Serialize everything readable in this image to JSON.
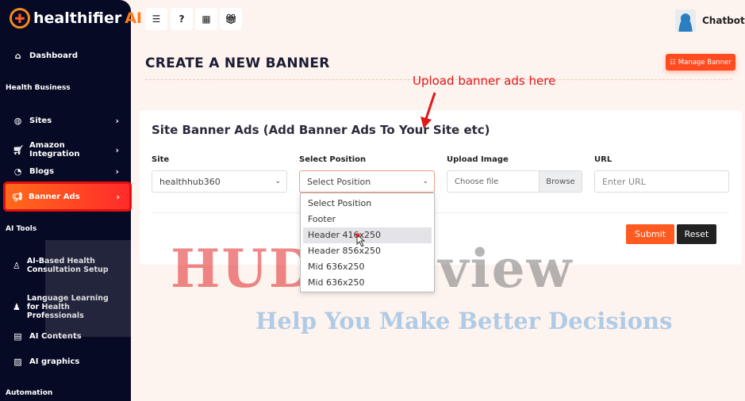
{
  "brand": {
    "name": "healthifier",
    "suffix": "AI"
  },
  "sidebar": {
    "dashboard": "Dashboard",
    "sections": {
      "health_business": "Health Business",
      "ai_tools": "AI Tools",
      "automation": "Automation"
    },
    "items": [
      {
        "label": "Sites",
        "icon": "globe-icon"
      },
      {
        "label": "Amazon Integration",
        "icon": "cart-icon"
      },
      {
        "label": "Blogs",
        "icon": "rss-icon"
      },
      {
        "label": "Banner Ads",
        "icon": "megaphone-icon",
        "active": true
      }
    ],
    "ai_items": [
      {
        "label": "AI-Based Health Consultation Setup"
      },
      {
        "label": "Language Learning for Health Professionals"
      },
      {
        "label": "AI Contents"
      },
      {
        "label": "AI graphics"
      }
    ]
  },
  "topbar": {
    "icons": [
      "menu-icon",
      "help-icon",
      "film-icon",
      "gift-icon"
    ],
    "user": "Chatbot"
  },
  "page": {
    "title": "CREATE A NEW BANNER",
    "manage_button": "Manage Banner",
    "annotation": "Upload banner ads here"
  },
  "form": {
    "title": "Site Banner Ads (Add Banner Ads To Your Site etc)",
    "site": {
      "label": "Site",
      "value": "healthhub360"
    },
    "position": {
      "label": "Select Position",
      "value": "Select Position",
      "options": [
        "Select Position",
        "Footer",
        "Header 416x250",
        "Header 856x250",
        "Mid 636x250",
        "Mid 636x250"
      ],
      "highlighted": 2
    },
    "image": {
      "label": "Upload Image",
      "placeholder": "Choose file",
      "browse": "Browse"
    },
    "url": {
      "label": "URL",
      "placeholder": "Enter URL"
    },
    "submit": "Submit",
    "reset": "Reset"
  },
  "watermark": {
    "line1a": "HUDA",
    "line1b": "Review",
    "line2": "Help You Make Better Decisions"
  },
  "colors": {
    "accent": "#ff5a1f",
    "sidebar": "#060a24"
  }
}
